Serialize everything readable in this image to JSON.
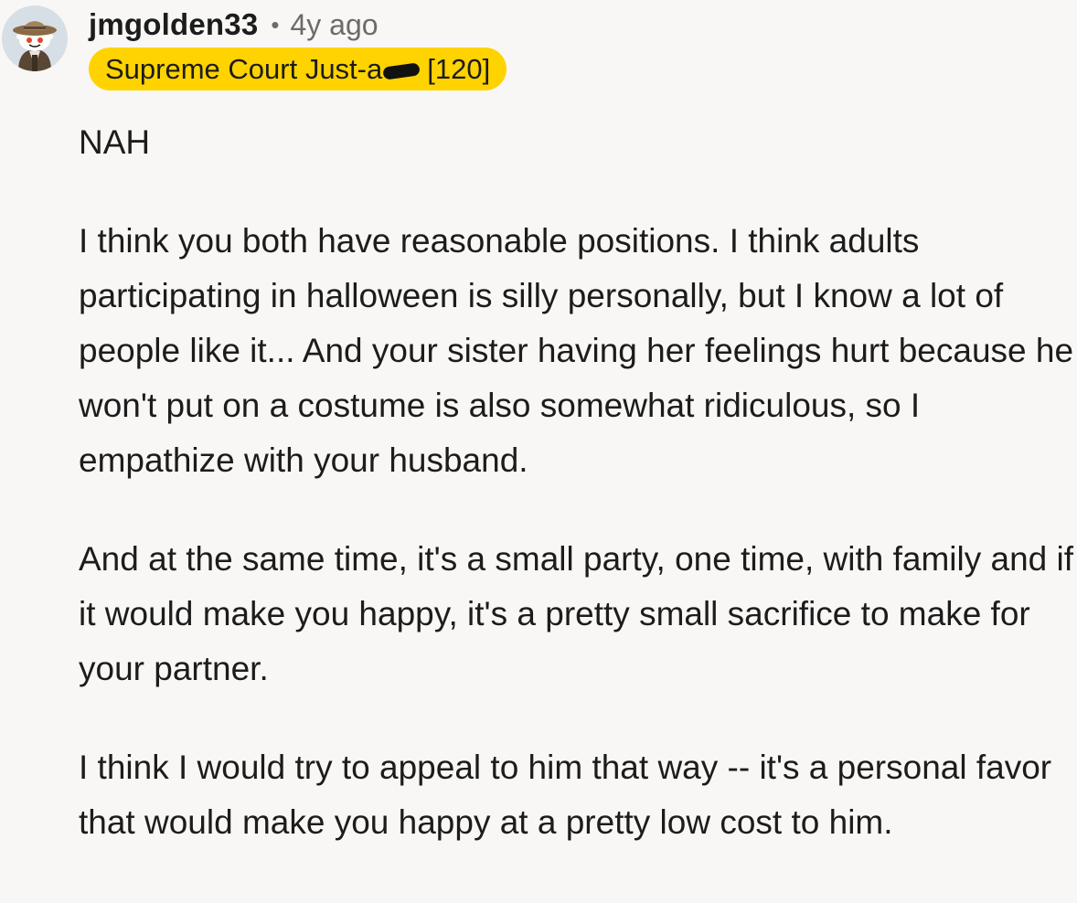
{
  "comment": {
    "author": "jmgolden33",
    "separator": "•",
    "age": "4y ago",
    "avatar_icon": "reddit-snoo-avatar-icon",
    "flair": {
      "text_before": "Supreme Court Just-a",
      "text_after": "[120]",
      "background": "#ffd300"
    },
    "paragraphs": [
      "NAH",
      "I think you both have reasonable positions. I think adults participating in halloween is silly personally, but I know a lot of people like it... And your sister having her feelings hurt because he won't put on a costume is also somewhat ridiculous, so I empathize with your husband.",
      "And at the same time, it's a small party, one time, with family and if it would make you happy, it's a pretty small sacrifice to make for your partner.",
      "I think I would try to appeal to him that way -- it's a personal favor that would make you happy at a pretty low cost to him."
    ]
  }
}
